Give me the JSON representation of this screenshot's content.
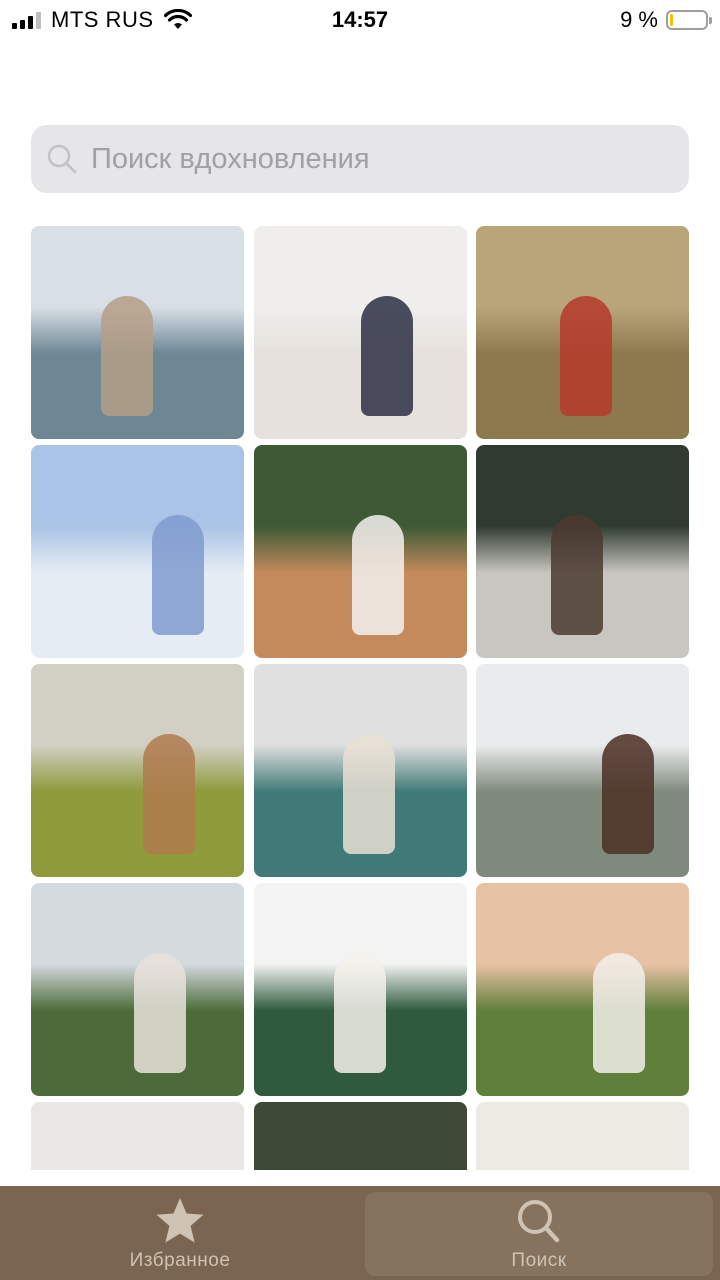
{
  "status_bar": {
    "carrier": "MTS RUS",
    "time": "14:57",
    "battery_percent_text": "9 %",
    "battery_level": 0.09,
    "signal_bars": 3,
    "icons": [
      "signal-icon",
      "wifi-icon",
      "battery-icon"
    ]
  },
  "search": {
    "placeholder": "Поиск вдохновления",
    "value": "",
    "icon": "search-icon"
  },
  "grid": {
    "tiles": [
      {
        "name": "photo-beach-woman",
        "colors": [
          "#d8dfe6",
          "#6d8795",
          "#b59f86"
        ]
      },
      {
        "name": "photo-girl-on-floor-with-cake",
        "colors": [
          "#efeeec",
          "#e6e1dc",
          "#2b2f44"
        ]
      },
      {
        "name": "photo-picnic-red-dress",
        "colors": [
          "#b9a57a",
          "#8c7a4e",
          "#b53a2c"
        ]
      },
      {
        "name": "photo-field-of-daisies",
        "colors": [
          "#a9c4e6",
          "#e6ecf3",
          "#7f9bcf"
        ]
      },
      {
        "name": "photo-christmas-mug",
        "colors": [
          "#3d5a35",
          "#c48a5c",
          "#f4f1ee"
        ]
      },
      {
        "name": "photo-cabin-window",
        "colors": [
          "#2f3b30",
          "#c9c6c1",
          "#4b3a2f"
        ]
      },
      {
        "name": "photo-wheat-field-hair",
        "colors": [
          "#d2d0c4",
          "#8f9a3b",
          "#b07a4e"
        ]
      },
      {
        "name": "photo-cafe-peonies",
        "colors": [
          "#dfe0df",
          "#3f7a78",
          "#e9dfd4"
        ]
      },
      {
        "name": "photo-misty-mountains",
        "colors": [
          "#e9ebec",
          "#7e8b7c",
          "#4b2e23"
        ]
      },
      {
        "name": "photo-green-meadow",
        "colors": [
          "#d5dadf",
          "#4d6b3a",
          "#e9e2dc"
        ]
      },
      {
        "name": "photo-winter-moscow",
        "colors": [
          "#f3f3f4",
          "#2f5a3b",
          "#f5f1ec"
        ]
      },
      {
        "name": "photo-couple-picnic-dog",
        "colors": [
          "#e8c2a5",
          "#5f7f3a",
          "#f2efea"
        ]
      },
      {
        "name": "photo-bath-bubbles",
        "colors": [
          "#e8e7e5",
          "#c9c7c4",
          "#b79a86"
        ]
      },
      {
        "name": "photo-tangerines-cotton",
        "colors": [
          "#3e4a36",
          "#e07a2e",
          "#f3f0ea"
        ]
      },
      {
        "name": "photo-interior-arch",
        "colors": [
          "#ede9e3",
          "#c8c2b9",
          "#6a4b3a"
        ]
      }
    ]
  },
  "tab_bar": {
    "tabs": [
      {
        "label": "Избранное",
        "icon": "star-icon",
        "active": false
      },
      {
        "label": "Поиск",
        "icon": "search-icon",
        "active": true
      }
    ],
    "colors": {
      "background": "#7a6650",
      "active": "#86735e",
      "label": "#cfc3b3"
    }
  }
}
